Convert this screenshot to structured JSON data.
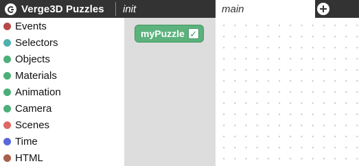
{
  "header": {
    "app_title": "Verge3D Puzzles",
    "logo_icon": "verge3d-logo-icon",
    "add_tab_icon": "plus-icon"
  },
  "tabs": [
    {
      "label": "init",
      "active": false
    },
    {
      "label": "main",
      "active": true
    }
  ],
  "sidebar": {
    "categories": [
      {
        "label": "Events",
        "color": "#b64a4a"
      },
      {
        "label": "Selectors",
        "color": "#4fb0b0"
      },
      {
        "label": "Objects",
        "color": "#4caf78"
      },
      {
        "label": "Materials",
        "color": "#4caf78"
      },
      {
        "label": "Animation",
        "color": "#4caf78"
      },
      {
        "label": "Camera",
        "color": "#4caf78"
      },
      {
        "label": "Scenes",
        "color": "#e06666"
      },
      {
        "label": "Time",
        "color": "#5b67d8"
      },
      {
        "label": "HTML",
        "color": "#a8604a"
      }
    ]
  },
  "flyout": {
    "block_label": "myPuzzle",
    "block_checked": true,
    "block_color": "#5cb27d"
  }
}
